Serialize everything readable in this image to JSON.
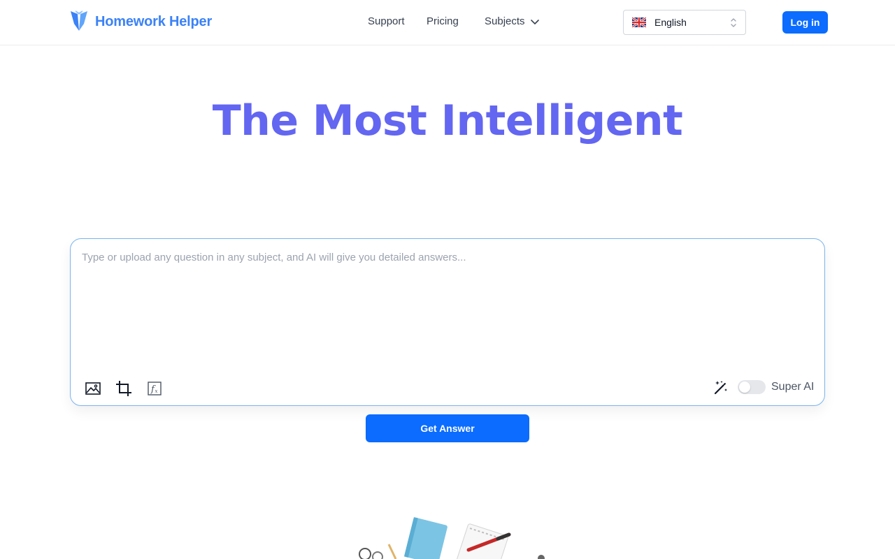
{
  "header": {
    "brand_name": "Homework Helper",
    "nav": {
      "support": "Support",
      "pricing": "Pricing",
      "subjects": "Subjects"
    },
    "language": {
      "selected": "English",
      "flag_icon": "uk-flag-icon"
    },
    "login_label": "Log in"
  },
  "hero": {
    "title": "The Most Intelligent"
  },
  "question_box": {
    "placeholder": "Type or upload any question in any subject, and AI will give you detailed answers...",
    "value": "",
    "tools": [
      "image-upload-icon",
      "crop-icon",
      "formula-icon"
    ],
    "magic_icon": "magic-wand-icon",
    "super_ai_label": "Super AI",
    "super_ai_enabled": false
  },
  "get_answer_label": "Get Answer",
  "colors": {
    "brand": "#3b82f6",
    "hero": "#6366f1",
    "primary_button": "#0b6cff",
    "box_border": "#7ab3f0"
  }
}
